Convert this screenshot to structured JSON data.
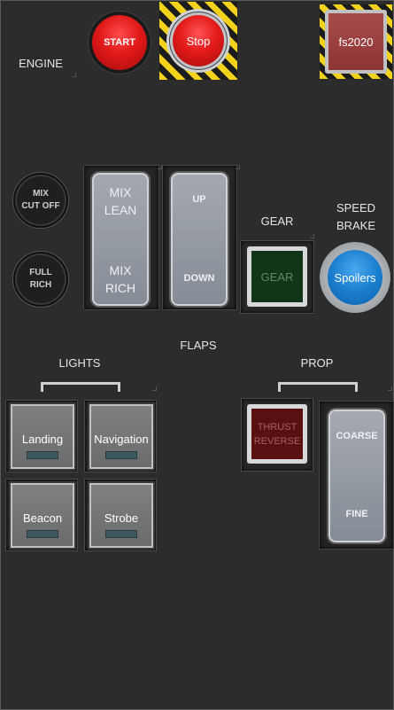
{
  "engine": {
    "label": "ENGINE",
    "start_label": "START",
    "stop_label": "Stop",
    "fs2020_label": "fs2020"
  },
  "mixture": {
    "cut_off_label": "MIX\nCUT OFF",
    "full_rich_label": "FULL\nRICH",
    "lever_top_label": "MIX\nLEAN",
    "lever_bottom_label": "MIX\nRICH"
  },
  "flaps": {
    "label": "FLAPS",
    "up_label": "UP",
    "down_label": "DOWN"
  },
  "gear": {
    "label": "GEAR",
    "button_label": "GEAR"
  },
  "speed_brake": {
    "label": "SPEED\nBRAKE",
    "button_label": "Spoilers"
  },
  "lights": {
    "label": "LIGHTS",
    "landing_label": "Landing",
    "navigation_label": "Navigation",
    "beacon_label": "Beacon",
    "strobe_label": "Strobe"
  },
  "prop": {
    "label": "PROP",
    "thrust_reverse_label": "THRUST\nREVERSE",
    "coarse_label": "COARSE",
    "fine_label": "FINE"
  }
}
